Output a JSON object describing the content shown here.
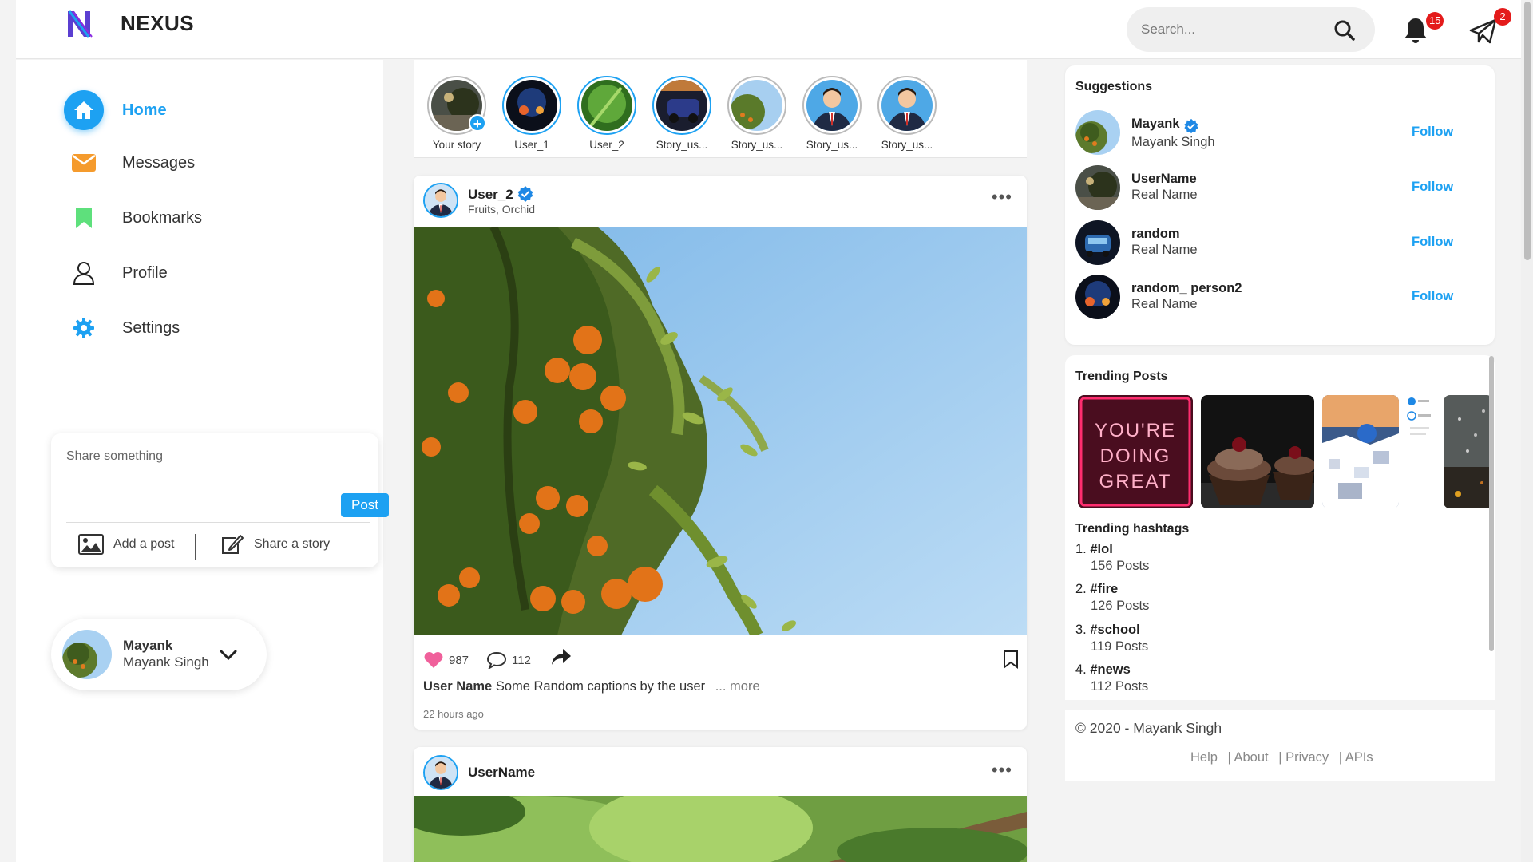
{
  "header": {
    "brand": "NEXUS",
    "search_placeholder": "Search...",
    "notifications_count": "15",
    "messages_count": "2"
  },
  "sidebar": {
    "items": [
      {
        "label": "Home",
        "icon": "home-icon",
        "active": true
      },
      {
        "label": "Messages",
        "icon": "mail-icon"
      },
      {
        "label": "Bookmarks",
        "icon": "bookmark-icon"
      },
      {
        "label": "Profile",
        "icon": "user-icon"
      },
      {
        "label": "Settings",
        "icon": "gear-icon"
      }
    ]
  },
  "share": {
    "placeholder": "Share something",
    "post_label": "Post",
    "add_post_label": "Add a post",
    "share_story_label": "Share a story"
  },
  "current_user": {
    "name": "Mayank",
    "full_name": "Mayank Singh"
  },
  "stories": [
    {
      "label": "Your story"
    },
    {
      "label": "User_1"
    },
    {
      "label": "User_2"
    },
    {
      "label": "Story_us..."
    },
    {
      "label": "Story_us..."
    },
    {
      "label": "Story_us..."
    },
    {
      "label": "Story_us..."
    }
  ],
  "post": {
    "user": "User_2",
    "location": "Fruits, Orchid",
    "likes": "987",
    "comments": "112",
    "caption_user": "User Name",
    "caption_text": "Some Random captions by the user",
    "more_label": "... more",
    "time": "22 hours ago"
  },
  "post2": {
    "user": "UserName"
  },
  "suggestions": {
    "title": "Suggestions",
    "follow_label": "Follow",
    "items": [
      {
        "name": "Mayank",
        "real_name": "Mayank Singh",
        "verified": true
      },
      {
        "name": "UserName",
        "real_name": "Real Name"
      },
      {
        "name": "random",
        "real_name": "Real Name"
      },
      {
        "name": "random_ person2",
        "real_name": "Real Name"
      }
    ]
  },
  "trending": {
    "title": "Trending Posts",
    "thumb_text": [
      "YOU'RE",
      "DOING",
      "GREAT"
    ],
    "hashtags_title": "Trending hashtags",
    "hashtags": [
      {
        "rank": "1.",
        "tag": "#lol",
        "posts": "156 Posts"
      },
      {
        "rank": "2.",
        "tag": "#fire",
        "posts": "126 Posts"
      },
      {
        "rank": "3.",
        "tag": "#school",
        "posts": "119 Posts"
      },
      {
        "rank": "4.",
        "tag": "#news",
        "posts": "112 Posts"
      }
    ]
  },
  "footer": {
    "copyright": "© 2020 - Mayank Singh",
    "links": [
      "Help",
      "| About",
      "| Privacy",
      "| APIs"
    ]
  },
  "colors": {
    "accent": "#1da1f2",
    "badge": "#e41b1b",
    "heart": "#f0609b"
  }
}
